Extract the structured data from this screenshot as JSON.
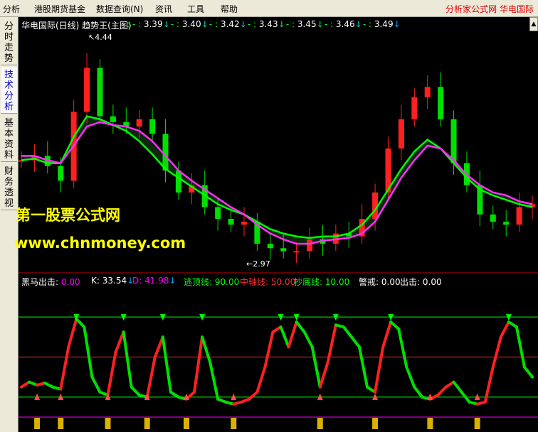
{
  "menubar": {
    "items": [
      "分析",
      "港股期货基金",
      "数据查询(N)",
      "资讯",
      "工具",
      "帮助"
    ],
    "title": "分析家公式网  华电国际"
  },
  "side_tabs": [
    {
      "label": "分时走势",
      "active": false
    },
    {
      "label": "技术分析",
      "active": true
    },
    {
      "label": "基本资料",
      "active": false
    },
    {
      "label": "财务透视",
      "active": false
    }
  ],
  "main_panel": {
    "header": {
      "title": "华电国际(日线) 趋势王(主图)",
      "levels": [
        "3.39",
        "3.40",
        "3.42",
        "3.43",
        "3.45",
        "3.46",
        "3.49"
      ]
    },
    "high_label": "4.44",
    "low_label": "2.97"
  },
  "watermark": {
    "line1": "第一股票公式网",
    "line2": "www.chnmoney.com"
  },
  "indicator_panel": {
    "items": [
      {
        "label": "黑马出击",
        "value": "0.00",
        "color": "#ffffff",
        "vcolor": "#ff00ff"
      },
      {
        "label": "K",
        "value": "33.54",
        "color": "#ffffff",
        "vcolor": "#ffffff"
      },
      {
        "label": "D",
        "value": "41.98",
        "color": "#ff00ff",
        "vcolor": "#ff00ff"
      },
      {
        "label": "逃顶线",
        "value": "90.00",
        "color": "#00ff00",
        "vcolor": "#00ff00"
      },
      {
        "label": "中轴线",
        "value": "50.00",
        "color": "#ff3030",
        "vcolor": "#ff3030"
      },
      {
        "label": "抄底线",
        "value": "10.00",
        "color": "#00ff00",
        "vcolor": "#00ff00"
      },
      {
        "label": "警戒",
        "value": "0.00",
        "color": "#ffffff",
        "vcolor": "#ffffff"
      },
      {
        "label": "出击",
        "value": "0.00",
        "color": "#ffffff",
        "vcolor": "#ffffff"
      }
    ],
    "line_colors": {
      "top": "#00ff00",
      "mid": "#ff3030",
      "bottom": "#00ff00"
    }
  },
  "chart_data": [
    {
      "type": "candlestick",
      "x": [
        0,
        5,
        10,
        15,
        20,
        25,
        30,
        35,
        40,
        45,
        50,
        55,
        60,
        65,
        70,
        75,
        80,
        85,
        90,
        95,
        100,
        105,
        110,
        115,
        120,
        125,
        130,
        135,
        140,
        145,
        150,
        155,
        160,
        165,
        170,
        175,
        180,
        185,
        190,
        195
      ],
      "y": [
        3.62,
        3.65,
        3.58,
        3.48,
        3.95,
        4.25,
        3.92,
        3.88,
        3.85,
        3.9,
        3.8,
        3.55,
        3.4,
        3.45,
        3.3,
        3.22,
        3.18,
        3.2,
        3.05,
        3.02,
        3.0,
        3.0,
        3.08,
        3.05,
        3.12,
        3.1,
        3.22,
        3.4,
        3.7,
        3.9,
        4.05,
        4.12,
        3.9,
        3.6,
        3.45,
        3.25,
        3.2,
        3.18,
        3.3,
        3.32
      ],
      "series": [
        {
          "values": [
            3.62,
            3.63,
            3.6,
            3.6,
            3.78,
            3.92,
            3.9,
            3.86,
            3.82,
            3.75,
            3.66,
            3.56,
            3.5,
            3.44,
            3.38,
            3.32,
            3.28,
            3.25,
            3.2,
            3.15,
            3.12,
            3.1,
            3.09,
            3.1,
            3.1,
            3.12,
            3.18,
            3.28,
            3.42,
            3.56,
            3.68,
            3.76,
            3.7,
            3.6,
            3.5,
            3.42,
            3.38,
            3.35,
            3.32,
            3.3
          ]
        },
        {
          "values": [
            3.65,
            3.65,
            3.62,
            3.6,
            3.72,
            3.85,
            3.88,
            3.86,
            3.85,
            3.82,
            3.75,
            3.65,
            3.55,
            3.48,
            3.42,
            3.36,
            3.3,
            3.25,
            3.18,
            3.12,
            3.08,
            3.05,
            3.05,
            3.07,
            3.08,
            3.09,
            3.12,
            3.2,
            3.35,
            3.5,
            3.62,
            3.72,
            3.7,
            3.62,
            3.52,
            3.45,
            3.4,
            3.38,
            3.34,
            3.32
          ]
        }
      ],
      "ylim": [
        2.9,
        4.5
      ]
    },
    {
      "type": "line",
      "x": [
        0,
        3,
        6,
        9,
        12,
        15,
        18,
        21,
        24,
        27,
        30,
        33,
        36,
        39,
        42,
        45,
        48,
        51,
        54,
        57,
        60,
        63,
        66,
        69,
        72,
        75,
        78,
        81,
        84,
        87,
        90,
        93,
        96,
        99,
        102,
        105,
        108,
        111,
        114,
        117,
        120,
        123,
        126,
        129,
        132,
        135,
        138,
        141,
        144,
        147,
        150,
        153,
        156,
        159,
        162,
        165,
        168,
        171,
        174,
        177,
        180,
        183,
        186,
        189,
        192,
        195
      ],
      "y": [
        20,
        25,
        22,
        24,
        20,
        18,
        60,
        88,
        80,
        30,
        15,
        12,
        55,
        75,
        20,
        12,
        10,
        50,
        70,
        15,
        10,
        8,
        15,
        70,
        45,
        8,
        5,
        3,
        5,
        8,
        15,
        40,
        75,
        80,
        60,
        85,
        75,
        60,
        20,
        45,
        82,
        80,
        70,
        60,
        20,
        15,
        60,
        85,
        78,
        40,
        20,
        10,
        8,
        12,
        20,
        25,
        15,
        5,
        3,
        5,
        40,
        70,
        85,
        80,
        40,
        30
      ],
      "series": [
        {
          "values": [
            20,
            25,
            22,
            24,
            20,
            18,
            60,
            88,
            80,
            30,
            15,
            12,
            55,
            75,
            20,
            12,
            10,
            50,
            70,
            15,
            10,
            8,
            15,
            70,
            45,
            8,
            5,
            3,
            5,
            8,
            15,
            40,
            75,
            80,
            60,
            85,
            75,
            60,
            20,
            45,
            82,
            80,
            70,
            60,
            20,
            15,
            60,
            85,
            78,
            40,
            20,
            10,
            8,
            12,
            20,
            25,
            15,
            5,
            3,
            5,
            40,
            70,
            85,
            80,
            40,
            30
          ]
        }
      ],
      "ylim": [
        -5,
        100
      ]
    }
  ]
}
